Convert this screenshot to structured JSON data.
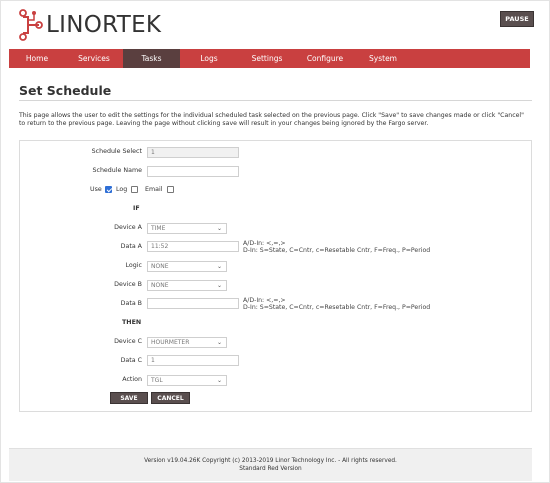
{
  "brand": {
    "name": "LINORTEK"
  },
  "header": {
    "pause_label": "PAUSE"
  },
  "nav": {
    "items": [
      "Home",
      "Services",
      "Tasks",
      "Logs",
      "Settings",
      "Configure",
      "System"
    ],
    "active": "Tasks"
  },
  "page": {
    "title": "Set Schedule",
    "description": "This page allows the user to edit the settings for the individual scheduled task selected on the previous page. Click \"Save\" to save changes made or click \"Cancel\" to return to the previous page. Leaving the page without clicking save will result in your changes being ignored by the Fargo server."
  },
  "form": {
    "schedule_select": {
      "label": "Schedule Select",
      "value": "1"
    },
    "schedule_name": {
      "label": "Schedule Name",
      "value": ""
    },
    "use": {
      "label": "Use",
      "checked": true
    },
    "log": {
      "label": "Log",
      "checked": false
    },
    "email": {
      "label": "Email",
      "checked": false
    },
    "if_label": "IF",
    "device_a": {
      "label": "Device A",
      "value": "TIME"
    },
    "data_a": {
      "label": "Data A",
      "value": "11:52",
      "hint_line1": "A/D-In: <,=,>",
      "hint_line2": "D-In: S=State, C=Cntr, c=Resetable Cntr, F=Freq., P=Period"
    },
    "logic": {
      "label": "Logic",
      "value": "NONE"
    },
    "device_b": {
      "label": "Device B",
      "value": "NONE"
    },
    "data_b": {
      "label": "Data B",
      "value": "",
      "hint_line1": "A/D-In: <,=,>",
      "hint_line2": "D-In: S=State, C=Cntr, c=Resetable Cntr, F=Freq., P=Period"
    },
    "then_label": "THEN",
    "device_c": {
      "label": "Device C",
      "value": "HOURMETER"
    },
    "data_c": {
      "label": "Data C",
      "value": "1"
    },
    "action": {
      "label": "Action",
      "value": "TGL"
    },
    "save_label": "SAVE",
    "cancel_label": "CANCEL"
  },
  "footer": {
    "line1": "Version v19.04.26K Copyright (c) 2013-2019 Linor Technology Inc. - All rights reserved.",
    "line2": "Standard Red Version"
  },
  "colors": {
    "accent": "#c94040",
    "active_tab": "#5a3f3f",
    "button": "#5a4f4f"
  }
}
